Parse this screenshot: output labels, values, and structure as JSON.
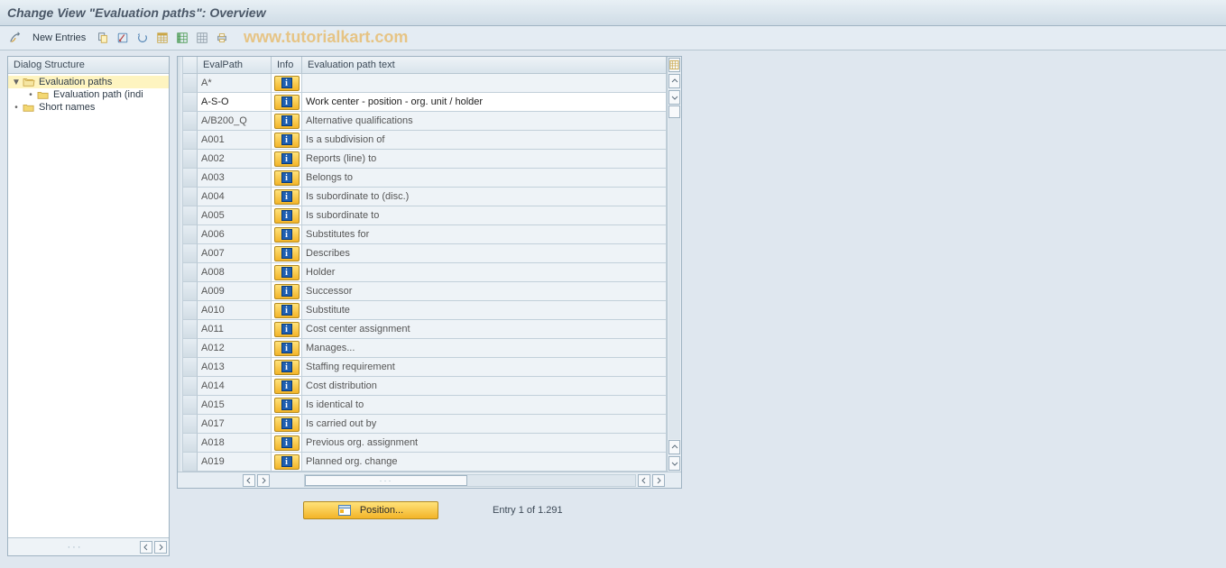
{
  "title": "Change View \"Evaluation paths\": Overview",
  "toolbar": {
    "new_entries": "New Entries"
  },
  "watermark": "www.tutorialkart.com",
  "dialog_structure": {
    "header": "Dialog Structure",
    "nodes": {
      "root": "Evaluation paths",
      "child1": "Evaluation path (indi",
      "sibling": "Short names"
    }
  },
  "table": {
    "columns": {
      "eval": "EvalPath",
      "info": "Info",
      "text": "Evaluation path text"
    },
    "rows": [
      {
        "eval": "A*",
        "text": ""
      },
      {
        "eval": "A-S-O",
        "text": "Work center - position - org. unit / holder"
      },
      {
        "eval": "A/B200_Q",
        "text": "Alternative qualifications"
      },
      {
        "eval": "A001",
        "text": "Is a subdivision of"
      },
      {
        "eval": "A002",
        "text": "Reports (line) to"
      },
      {
        "eval": "A003",
        "text": "Belongs to"
      },
      {
        "eval": "A004",
        "text": "Is subordinate to (disc.)"
      },
      {
        "eval": "A005",
        "text": "Is subordinate to"
      },
      {
        "eval": "A006",
        "text": "Substitutes for"
      },
      {
        "eval": "A007",
        "text": "Describes"
      },
      {
        "eval": "A008",
        "text": "Holder"
      },
      {
        "eval": "A009",
        "text": "Successor"
      },
      {
        "eval": "A010",
        "text": "Substitute"
      },
      {
        "eval": "A011",
        "text": "Cost center assignment"
      },
      {
        "eval": "A012",
        "text": "Manages..."
      },
      {
        "eval": "A013",
        "text": "Staffing requirement"
      },
      {
        "eval": "A014",
        "text": "Cost distribution"
      },
      {
        "eval": "A015",
        "text": "Is identical to"
      },
      {
        "eval": "A017",
        "text": "Is carried out by"
      },
      {
        "eval": "A018",
        "text": "Previous org. assignment"
      },
      {
        "eval": "A019",
        "text": "Planned org. change"
      }
    ]
  },
  "footer": {
    "position": "Position...",
    "entry": "Entry 1 of 1.291"
  }
}
